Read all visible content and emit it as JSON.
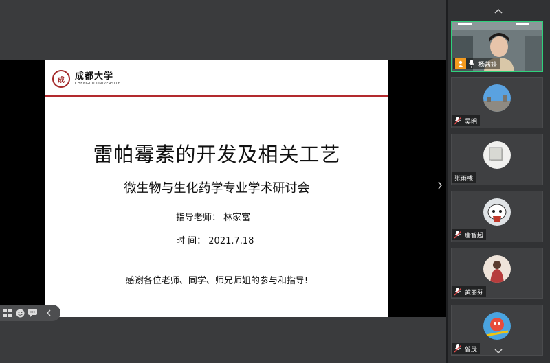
{
  "slide": {
    "logo_seal": "成",
    "logo_cn": "成都大学",
    "logo_en": "CHENGDU UNIVERSITY",
    "title": "雷帕霉素的开发及相关工艺",
    "subtitle": "微生物与生化药学专业学术研讨会",
    "advisor_line": "指导老师：  林家富",
    "time_label": "时      间：",
    "time_value": "2021.7.18",
    "thanks": "感谢各位老师、同学、师兄师姐的参与和指导!"
  },
  "participants": [
    {
      "name": "杨茜婷",
      "active": true,
      "icon": "person-video"
    },
    {
      "name": "吴明",
      "icon": "mic-muted-icon"
    },
    {
      "name": "张雨彧",
      "icon": "none"
    },
    {
      "name": "唐智超",
      "icon": "mic-muted-icon"
    },
    {
      "name": "黄丽芬",
      "icon": "mic-muted-icon"
    },
    {
      "name": "曾茂",
      "icon": "mic-muted-icon"
    }
  ],
  "colors": {
    "accent_rule": "#b32a2e",
    "active_border": "#2fd17c",
    "host_badge": "#f39a1e"
  }
}
